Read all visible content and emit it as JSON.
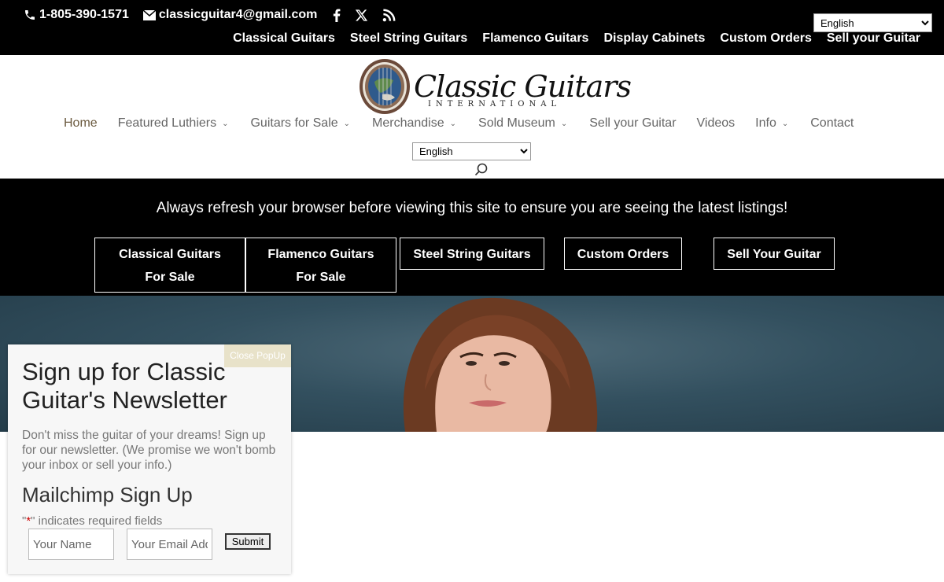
{
  "topbar": {
    "phone": "1-805-390-1571",
    "email": "classicguitar4@gmail.com",
    "social": [
      "facebook-icon",
      "x-icon",
      "rss-icon"
    ],
    "language": "English",
    "nav": [
      "Classical Guitars",
      "Steel String Guitars",
      "Flamenco Guitars",
      "Display Cabinets",
      "Custom Orders",
      "Sell your Guitar"
    ]
  },
  "header": {
    "logo_title": "Classic Guitars",
    "logo_sub": "INTERNATIONAL",
    "nav": [
      {
        "label": "Home",
        "has_dropdown": false,
        "active": true
      },
      {
        "label": "Featured Luthiers",
        "has_dropdown": true
      },
      {
        "label": "Guitars for Sale",
        "has_dropdown": true
      },
      {
        "label": "Merchandise",
        "has_dropdown": true
      },
      {
        "label": "Sold Museum",
        "has_dropdown": true
      },
      {
        "label": "Sell your Guitar",
        "has_dropdown": false
      },
      {
        "label": "Videos",
        "has_dropdown": false
      },
      {
        "label": "Info",
        "has_dropdown": true
      },
      {
        "label": "Contact",
        "has_dropdown": false
      }
    ],
    "language": "English"
  },
  "band": {
    "message": "Always refresh your browser before viewing this site to ensure you are seeing the latest listings!",
    "buttons": [
      {
        "line1": "Classical Guitars",
        "line2": "For Sale"
      },
      {
        "line1": "Flamenco Guitars",
        "line2": "For Sale"
      },
      {
        "line1": "Steel String Guitars",
        "line2": ""
      },
      {
        "line1": "Custom Orders",
        "line2": ""
      },
      {
        "line1": "Sell Your Guitar",
        "line2": ""
      }
    ]
  },
  "popup": {
    "close_label": "Close PopUp",
    "title": "Sign up for Classic Guitar's Newsletter",
    "description": "Don't miss the guitar of your dreams! Sign up for our newsletter. (We promise we won't bomb your inbox or sell your info.)",
    "form_title": "Mailchimp Sign Up",
    "required_prefix": "\"",
    "required_star": "*",
    "required_suffix": "\" indicates required fields",
    "name_placeholder": "Your Name",
    "email_placeholder": "Your Email Address",
    "submit_label": "Submit"
  },
  "colors": {
    "accent": "#6b5a3f",
    "band_bg": "#000000",
    "popup_close_bg": "#e8e2c9"
  }
}
